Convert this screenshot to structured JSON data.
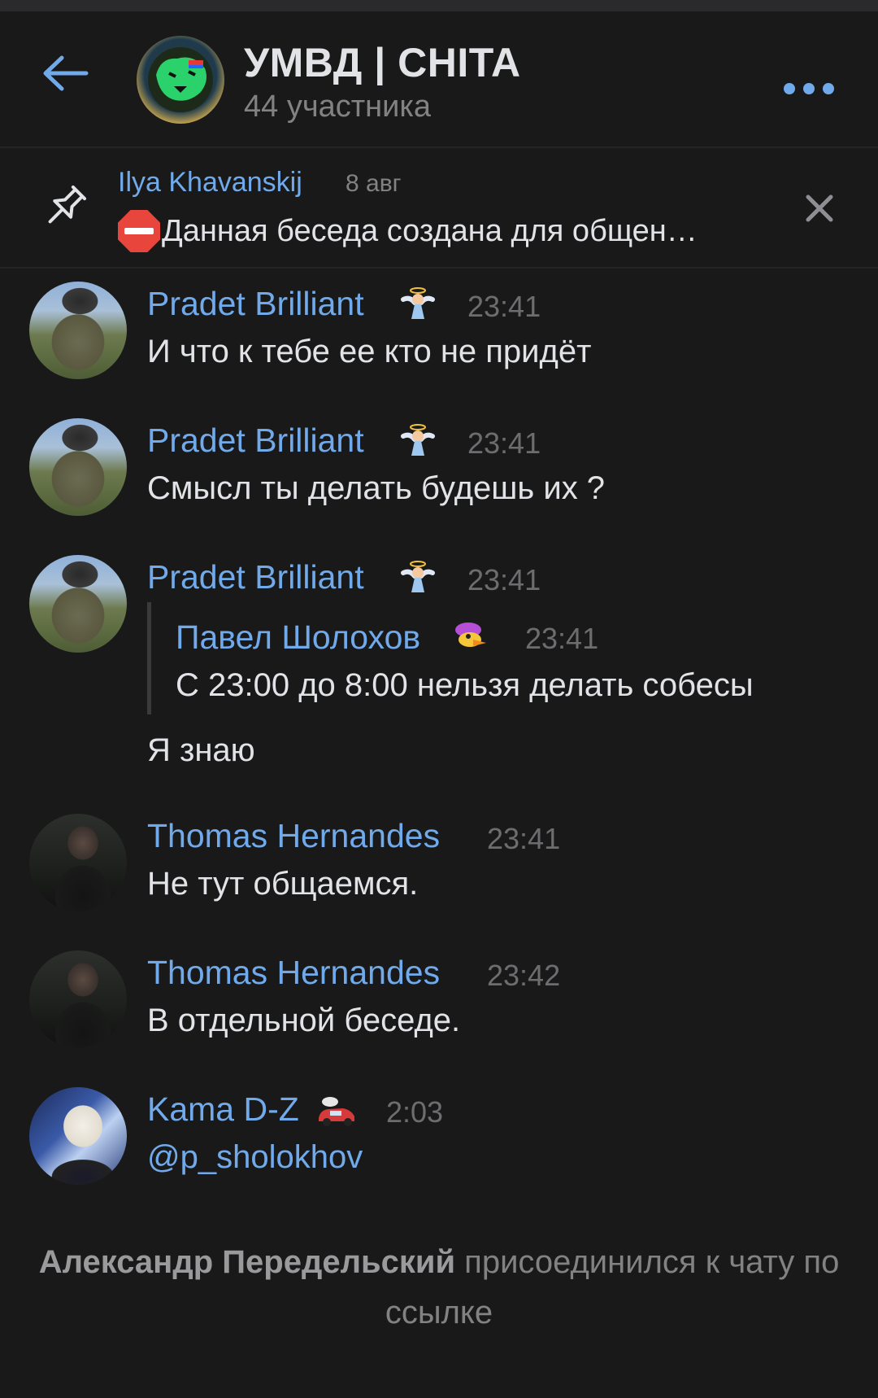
{
  "header": {
    "title": "УМВД | CHITA",
    "subtitle": "44 участника",
    "accent": "#71aaeb"
  },
  "pinned": {
    "author": "Ilya Khavanskij",
    "date": "8 авг",
    "text": "Данная беседа создана для общен…"
  },
  "messages": [
    {
      "author": "Pradet Brilliant",
      "time": "23:41",
      "text": "И что к тебе ее кто не придёт",
      "badge": "angel-icon"
    },
    {
      "author": "Pradet Brilliant",
      "time": "23:41",
      "text": "Смысл ты делать будешь их ?",
      "badge": "angel-icon"
    },
    {
      "author": "Pradet Brilliant",
      "time": "23:41",
      "text": "Я знаю",
      "badge": "angel-icon",
      "reply": {
        "author": "Павел Шолохов",
        "time": "23:41",
        "text": "С 23:00 до 8:00 нельзя делать собесы",
        "badge": "duck-icon"
      }
    },
    {
      "author": "Thomas Hernandes",
      "time": "23:41",
      "text": "Не тут общаемся."
    },
    {
      "author": "Thomas Hernandes",
      "time": "23:42",
      "text": "В отдельной беседе."
    },
    {
      "author": "Kama D-Z",
      "time": "2:03",
      "text": "@p_sholokhov",
      "badge": "car-icon"
    }
  ],
  "service": {
    "user": "Александр Передельский",
    "action": "присоединился к чату по ссылке"
  }
}
